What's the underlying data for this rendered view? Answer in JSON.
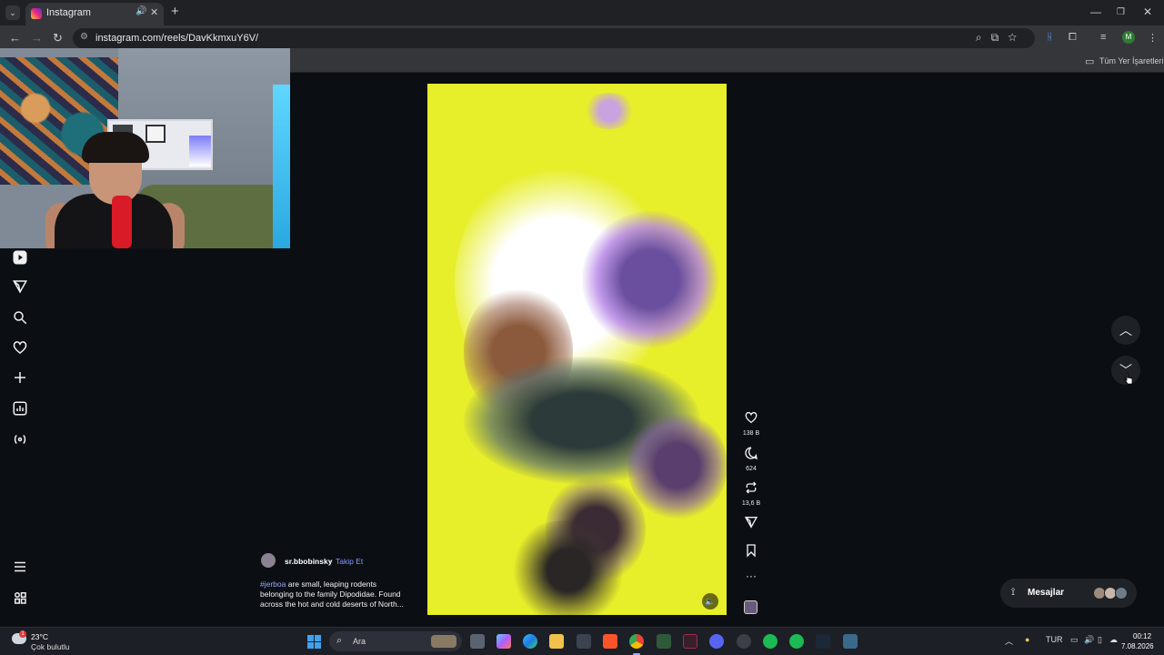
{
  "browser": {
    "tab_title": "Instagram",
    "url": "instagram.com/reels/DavKkmxuY6V/",
    "profile_initial": "M",
    "bookmarks_label": "Tüm Yer İşaretleri"
  },
  "reel": {
    "likes": "138 B",
    "comments": "624",
    "reposts": "13,6 B",
    "username": "sr.bbobinsky",
    "separator": "•",
    "follow_label": "Takip Et",
    "caption_tag": "#jerboa",
    "caption_text": " are small, leaping rodents belonging to the family Dipodidae. Found across the hot and cold deserts of North..."
  },
  "messages": {
    "label": "Mesajlar"
  },
  "taskbar": {
    "temperature": "23°C",
    "weather": "Çok bulutlu",
    "weather_badge": "1",
    "search_label": "Ara",
    "language": "TUR",
    "time": "00:12",
    "date": "7.08.2026"
  },
  "colors": {
    "reel_yellow": "#e7ee2a",
    "instagram_follow": "#8a95ff",
    "windows_blue": "#3fa2ee"
  }
}
